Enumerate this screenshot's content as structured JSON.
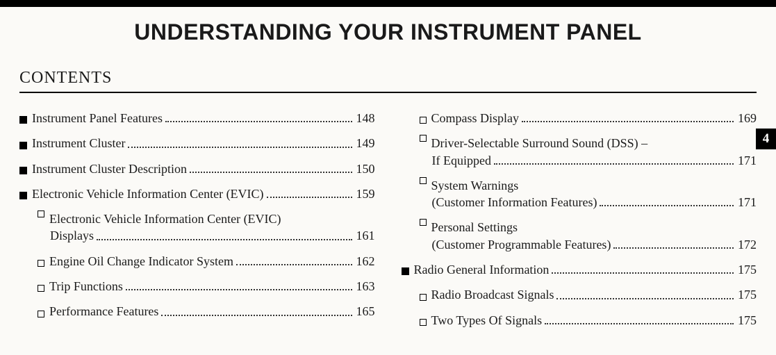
{
  "chapter_title": "UNDERSTANDING YOUR INSTRUMENT PANEL",
  "contents_label": "CONTENTS",
  "side_tab": "4",
  "left": [
    {
      "level": 0,
      "text": "Instrument Panel Features",
      "page": "148"
    },
    {
      "level": 0,
      "text": "Instrument Cluster",
      "page": "149"
    },
    {
      "level": 0,
      "text": "Instrument Cluster Description",
      "page": "150"
    },
    {
      "level": 0,
      "text": "Electronic Vehicle Information Center (EVIC)",
      "page": "159"
    },
    {
      "level": 1,
      "text_l1": "Electronic Vehicle Information Center (EVIC)",
      "text_l2": "Displays",
      "page": "161",
      "multiline": true
    },
    {
      "level": 1,
      "text": "Engine Oil Change Indicator System",
      "page": "162"
    },
    {
      "level": 1,
      "text": "Trip Functions",
      "page": "163"
    },
    {
      "level": 1,
      "text": "Performance Features",
      "page": "165"
    }
  ],
  "right": [
    {
      "level": 1,
      "text": "Compass Display",
      "page": "169"
    },
    {
      "level": 1,
      "text_l1": "Driver-Selectable Surround Sound (DSS) –",
      "text_l2": "If Equipped",
      "page": "171",
      "multiline": true
    },
    {
      "level": 1,
      "text_l1": "System Warnings",
      "text_l2": "(Customer Information Features)",
      "page": "171",
      "multiline": true
    },
    {
      "level": 1,
      "text_l1": "Personal Settings",
      "text_l2": "(Customer Programmable Features)",
      "page": "172",
      "multiline": true
    },
    {
      "level": 0,
      "text": "Radio General Information",
      "page": "175"
    },
    {
      "level": 1,
      "text": "Radio Broadcast Signals",
      "page": "175"
    },
    {
      "level": 1,
      "text": "Two Types Of Signals",
      "page": "175"
    }
  ]
}
